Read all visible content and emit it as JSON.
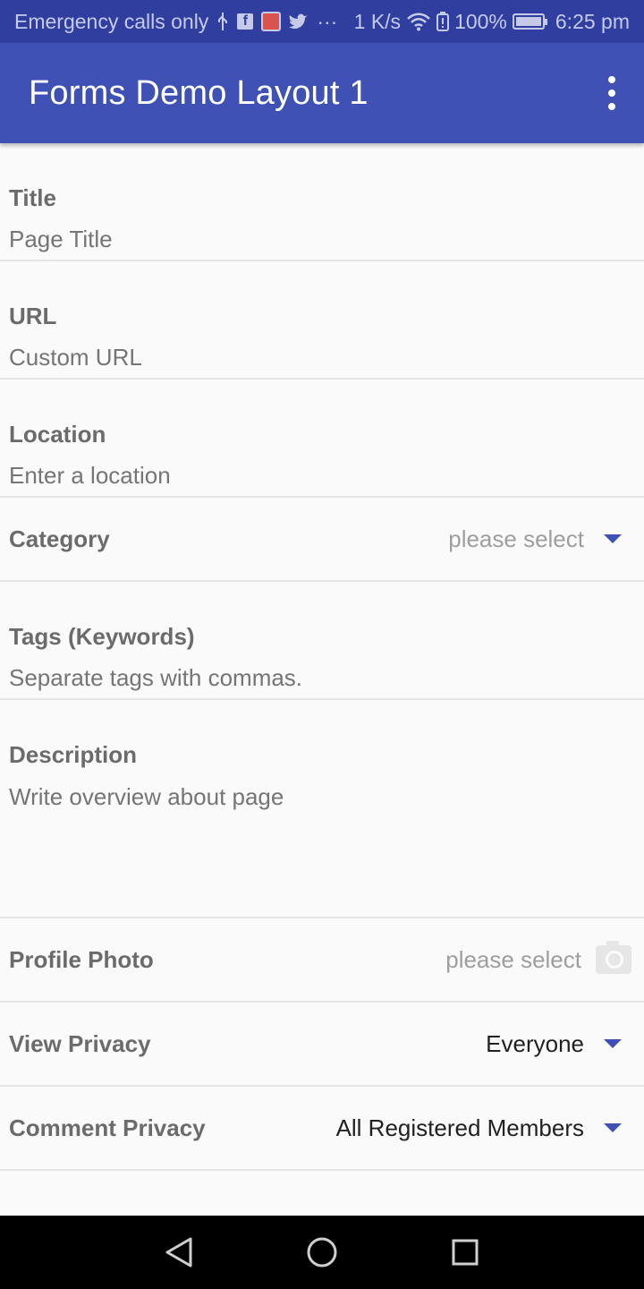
{
  "status_bar": {
    "carrier": "Emergency calls only",
    "speed": "1 K/s",
    "battery": "100%",
    "battery_level": 1.0,
    "time": "6:25 pm",
    "icons": [
      "usb-icon",
      "facebook-icon",
      "app-notification-icon",
      "twitter-icon",
      "more-notifications-icon",
      "wifi-icon",
      "battery-alert-icon",
      "battery-icon"
    ]
  },
  "app_bar": {
    "title": "Forms Demo Layout 1",
    "overflow_icon": "more-vert-icon",
    "color": "#3f51b5"
  },
  "form": {
    "title": {
      "label": "Title",
      "placeholder": "Page Title"
    },
    "url": {
      "label": "URL",
      "placeholder": "Custom URL"
    },
    "location": {
      "label": "Location",
      "placeholder": "Enter a location"
    },
    "category": {
      "label": "Category",
      "value": "please select"
    },
    "tags": {
      "label": "Tags (Keywords)",
      "placeholder": "Separate tags with commas."
    },
    "description": {
      "label": "Description",
      "placeholder": "Write overview about page"
    },
    "profile_photo": {
      "label": "Profile Photo",
      "value": "please select",
      "icon": "camera-icon"
    },
    "view_privacy": {
      "label": "View Privacy",
      "value": "Everyone"
    },
    "comment_privacy": {
      "label": "Comment Privacy",
      "value": "All Registered Members"
    }
  },
  "nav_bar": {
    "icons": [
      "back-icon",
      "home-icon",
      "recents-icon"
    ]
  }
}
